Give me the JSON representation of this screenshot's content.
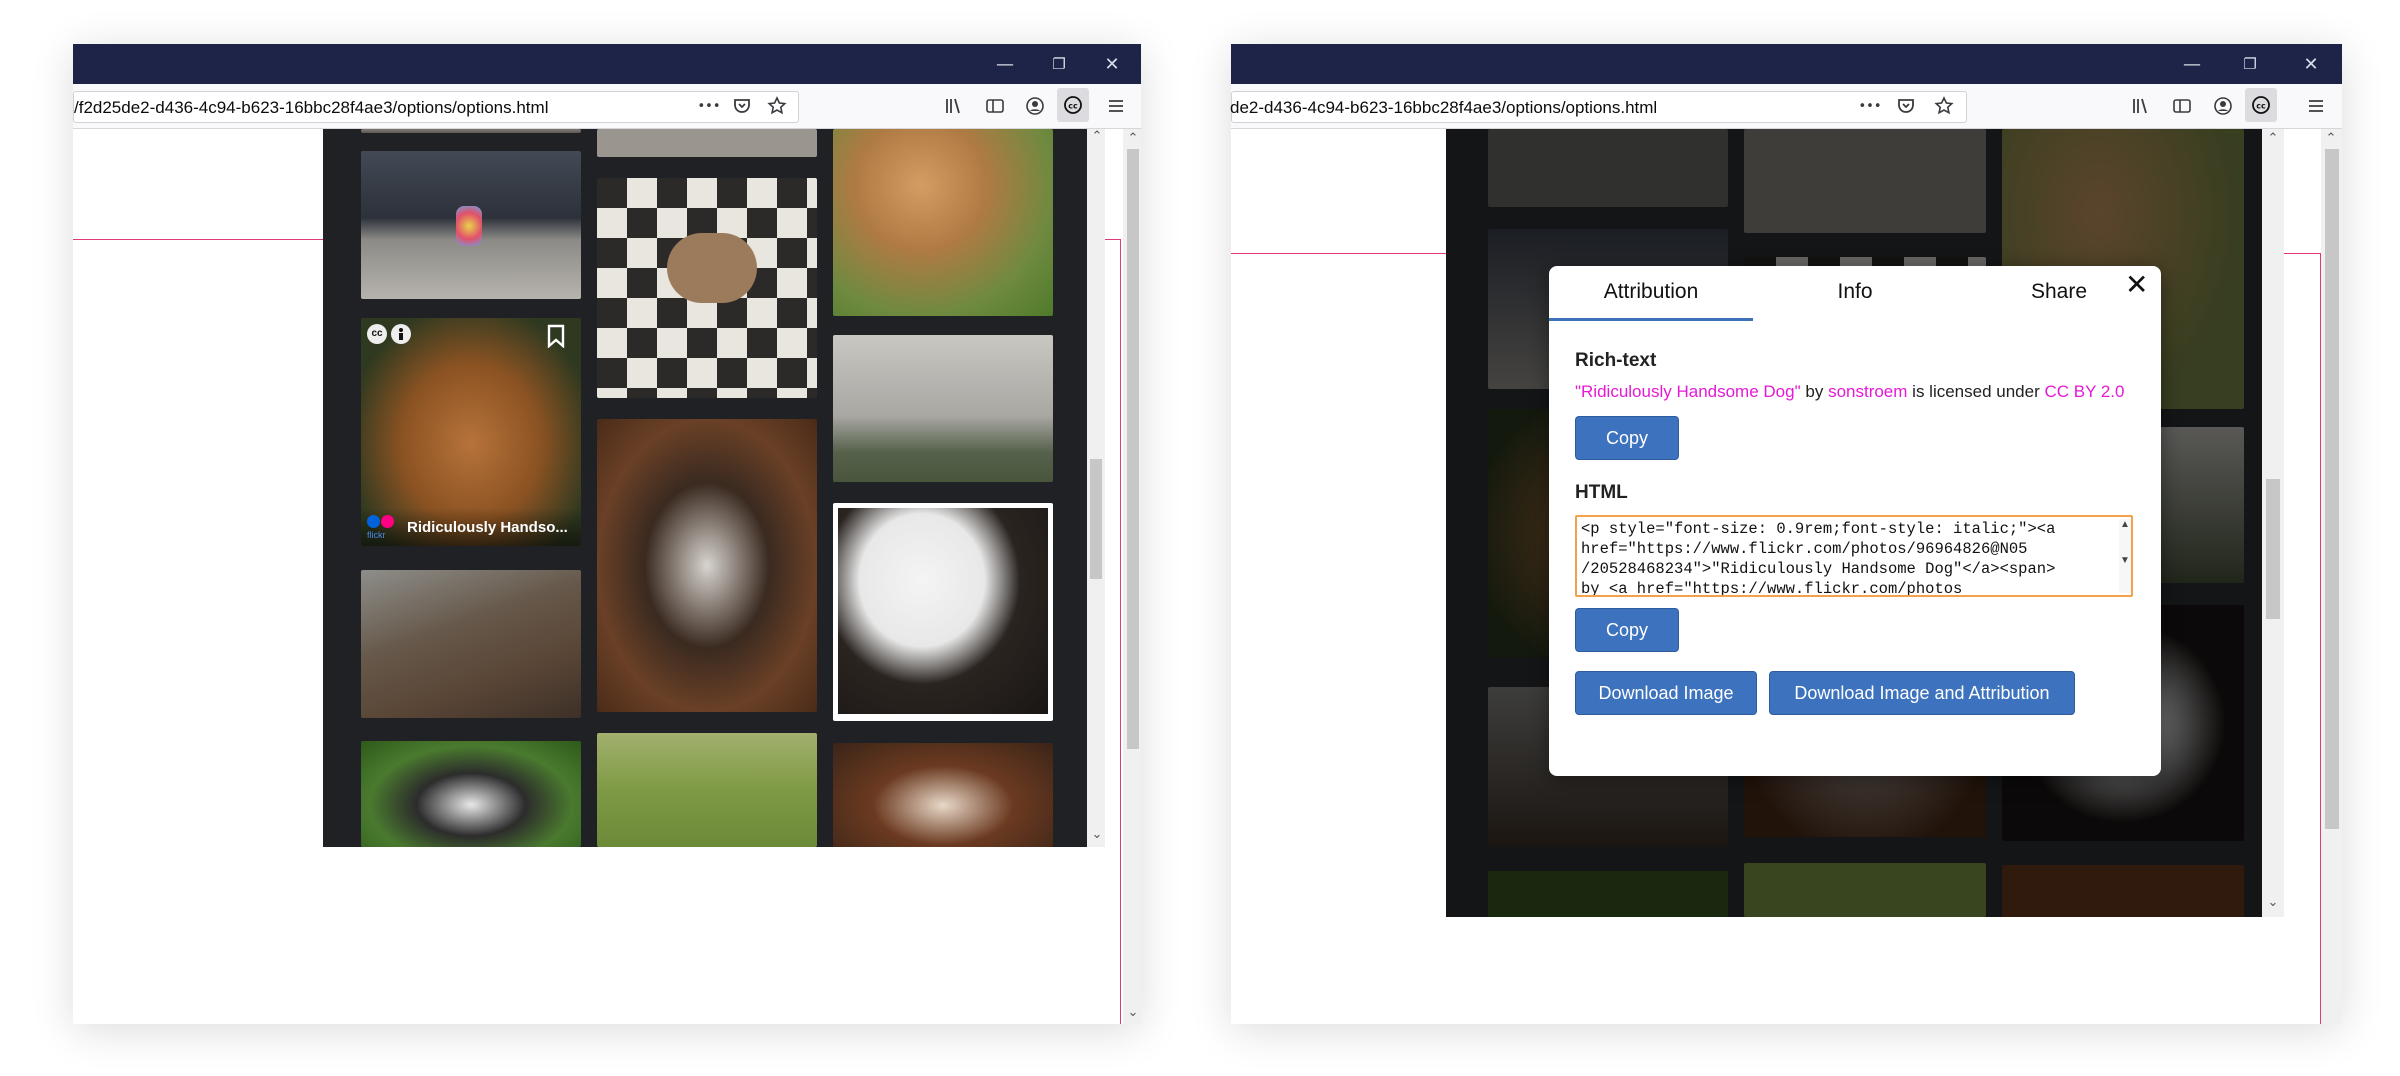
{
  "left_window": {
    "url": "/f2d25de2-d436-4c94-b623-16bbc28f4ae3/options/options.html",
    "overflow_glyph": "•••",
    "title_buttons": {
      "minimize": "—",
      "restore": "❐",
      "close": "✕"
    },
    "hovered_card_title": "Ridiculously Handso...",
    "flickr_label": "flickr",
    "cc_badge": "cc",
    "scroll_up": "⌃",
    "scroll_down": "⌄"
  },
  "right_window": {
    "url": "de2-d436-4c94-b623-16bbc28f4ae3/options/options.html",
    "overflow_glyph": "•••",
    "title_buttons": {
      "minimize": "—",
      "restore": "❐",
      "close": "✕"
    },
    "modal": {
      "tabs": [
        "Attribution",
        "Info",
        "Share"
      ],
      "close_label": "✕",
      "rich_text_heading": "Rich-text",
      "rich_text": {
        "title": "\"Ridiculously Handsome Dog\"",
        "by": "by",
        "author": "sonstroem",
        "licensed": "is licensed under",
        "license": "CC BY 2.0"
      },
      "copy_label": "Copy",
      "html_heading": "HTML",
      "html_code": "<p style=\"font-size: 0.9rem;font-style: italic;\"><a\nhref=\"https://www.flickr.com/photos/96964826@N05\n/20528468234\">\"Ridiculously Handsome Dog\"</a><span>\nby <a href=\"https://www.flickr.com/photos",
      "download_image_label": "Download Image",
      "download_attr_label": "Download Image and Attribution"
    }
  },
  "colors": {
    "titlebar": "#1e2447",
    "button": "#3d72be",
    "link": "#e61ad6",
    "accent_pink": "#e03a7a",
    "code_border": "#f3a14a"
  }
}
